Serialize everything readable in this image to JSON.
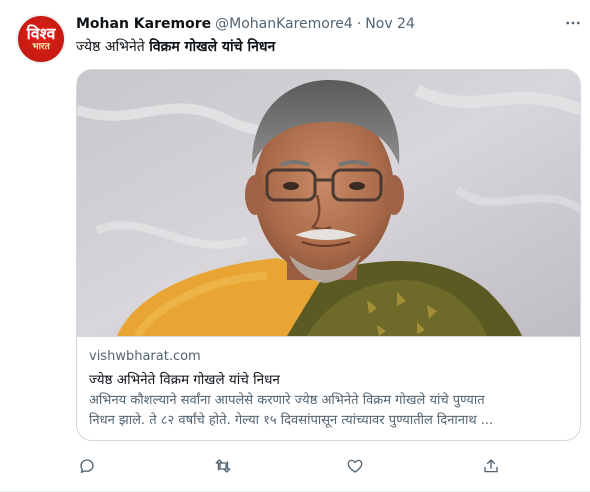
{
  "author": {
    "avatar_line1": "विश्व",
    "avatar_line2": "भारत",
    "name": "Mohan Karemore",
    "handle": "@MohanKaremore4",
    "separator": "·",
    "date": "Nov 24"
  },
  "tweet": {
    "text_plain": "ज्येष्ठ अभिनेते ",
    "text_bold": "विक्रम गोखले यांचे निधन"
  },
  "card": {
    "domain": "vishwbharat.com",
    "title": "ज्येष्ठ अभिनेते विक्रम गोखले यांचे निधन",
    "description_line1": "अभिनय कौशल्याने सर्वांना आपलेसे करणारे ज्येष्ठ अभिनेते विक्रम गोखले यांचे पुण्यात",
    "description_line2": "निधन झाले. ते ८२ वर्षांचे होते. गेल्या १५ दिवसांपासून त्यांच्यावर पुण्यातील दिनानाथ ..."
  },
  "actions": [
    "reply-icon",
    "retweet-icon",
    "like-icon",
    "share-icon"
  ],
  "colors": {
    "text_primary": "#0f1419",
    "text_secondary": "#536471",
    "border": "#cfd9de",
    "avatar_red": "#e2231a"
  }
}
